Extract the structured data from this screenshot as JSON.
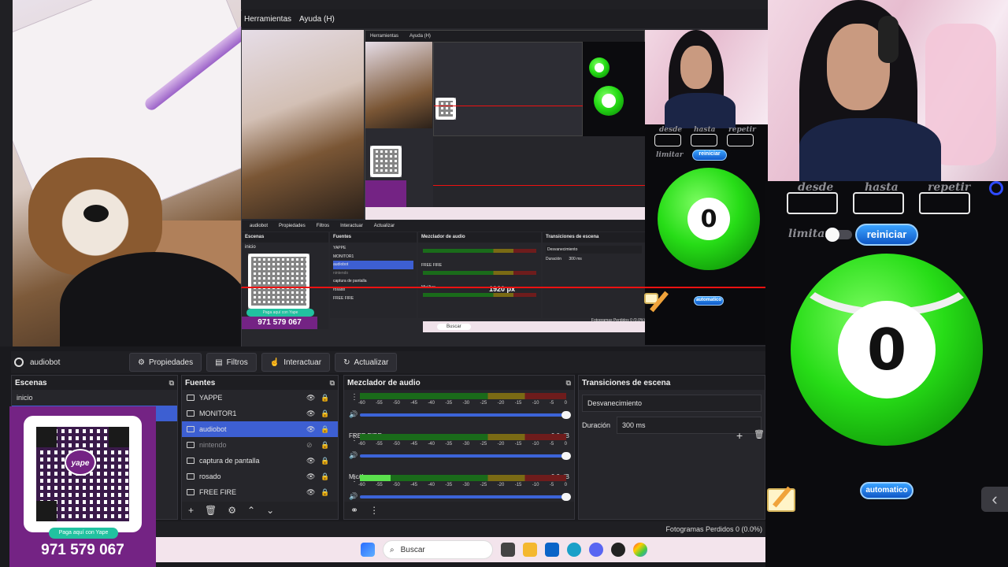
{
  "menu": {
    "tools": "Herramientas",
    "help": "Ayuda (H)"
  },
  "nested_menu": {
    "tools": "Herramientas",
    "help": "Ayuda (H)"
  },
  "nested_toolbar": {
    "source": "audiobot",
    "props": "Propiedades",
    "filters": "Filtros",
    "interact": "Interactuar",
    "refresh": "Actualizar"
  },
  "nested_docks": {
    "scenes": "Escenas",
    "scene1": "inicio",
    "sources": "Fuentes",
    "mixer": "Mezclador de audio",
    "transitions": "Transiciones de escena",
    "trans_value": "Desvanecimiento",
    "duration_label": "Duración",
    "duration_value": "300 ms",
    "src": [
      "YAPPE",
      "MONITOR1",
      "audiobot",
      "nintendo",
      "captura de pantalla",
      "rosado",
      "FREE FIRE"
    ],
    "freefire": "FREE FIRE",
    "mic": "Mic/Aux",
    "px_label": "1920 px",
    "search": "Buscar",
    "dropped": "Fotogramas Perdidos 0 (0.0%)"
  },
  "nested_yape_number": "971 579 067",
  "nested_yape_pill": "Paga aquí con Yape",
  "ball_panel": {
    "from_label": "desde",
    "to_label": "hasta",
    "repeat_label": "repetir",
    "limit_label": "limitar",
    "restart_button": "reiniciar",
    "auto_button": "automatico",
    "ball_number": "0"
  },
  "toolbar": {
    "source_name": "audiobot",
    "properties": "Propiedades",
    "filters": "Filtros",
    "interact": "Interactuar",
    "refresh": "Actualizar"
  },
  "scenes": {
    "title": "Escenas",
    "items": [
      "inicio",
      ""
    ]
  },
  "sources": {
    "title": "Fuentes",
    "items": [
      {
        "name": "YAPPE",
        "icon": "image-icon"
      },
      {
        "name": "MONITOR1",
        "icon": "monitor-icon"
      },
      {
        "name": "audiobot",
        "icon": "browser-icon"
      },
      {
        "name": "nintendo",
        "icon": "capture-icon"
      },
      {
        "name": "captura de pantalla",
        "icon": "capture-icon"
      },
      {
        "name": "rosado",
        "icon": "image-icon"
      },
      {
        "name": "FREE FIRE",
        "icon": "window-icon"
      }
    ]
  },
  "mixer": {
    "title": "Mezclador de audio",
    "channels": [
      {
        "name": "",
        "db": "",
        "level": 0.0
      },
      {
        "name": "FREE FIRE",
        "db": "0.0 dB",
        "level": 0.0
      },
      {
        "name": "Mic/Aux",
        "db": "0.0 dB",
        "level": 0.15
      }
    ],
    "ticks": [
      "-60",
      "-55",
      "-50",
      "-45",
      "-40",
      "-35",
      "-30",
      "-25",
      "-20",
      "-15",
      "-10",
      "-5",
      "0"
    ]
  },
  "transitions": {
    "title": "Transiciones de escena",
    "type": "Desvanecimiento",
    "duration_label": "Duración",
    "duration_value": "300 ms"
  },
  "status": {
    "dropped_frames": "Fotogramas Perdidos 0 (0.0%)"
  },
  "taskbar": {
    "search_placeholder": "Buscar"
  },
  "yape": {
    "logo": "yape",
    "pay_here": "Paga aquí con Yape",
    "number": "971 579 067"
  },
  "colors": {
    "accent": "#3d5fd2",
    "ball_green": "#27dd17",
    "yape_purple": "#742384",
    "button_blue": "#1a7be6"
  }
}
